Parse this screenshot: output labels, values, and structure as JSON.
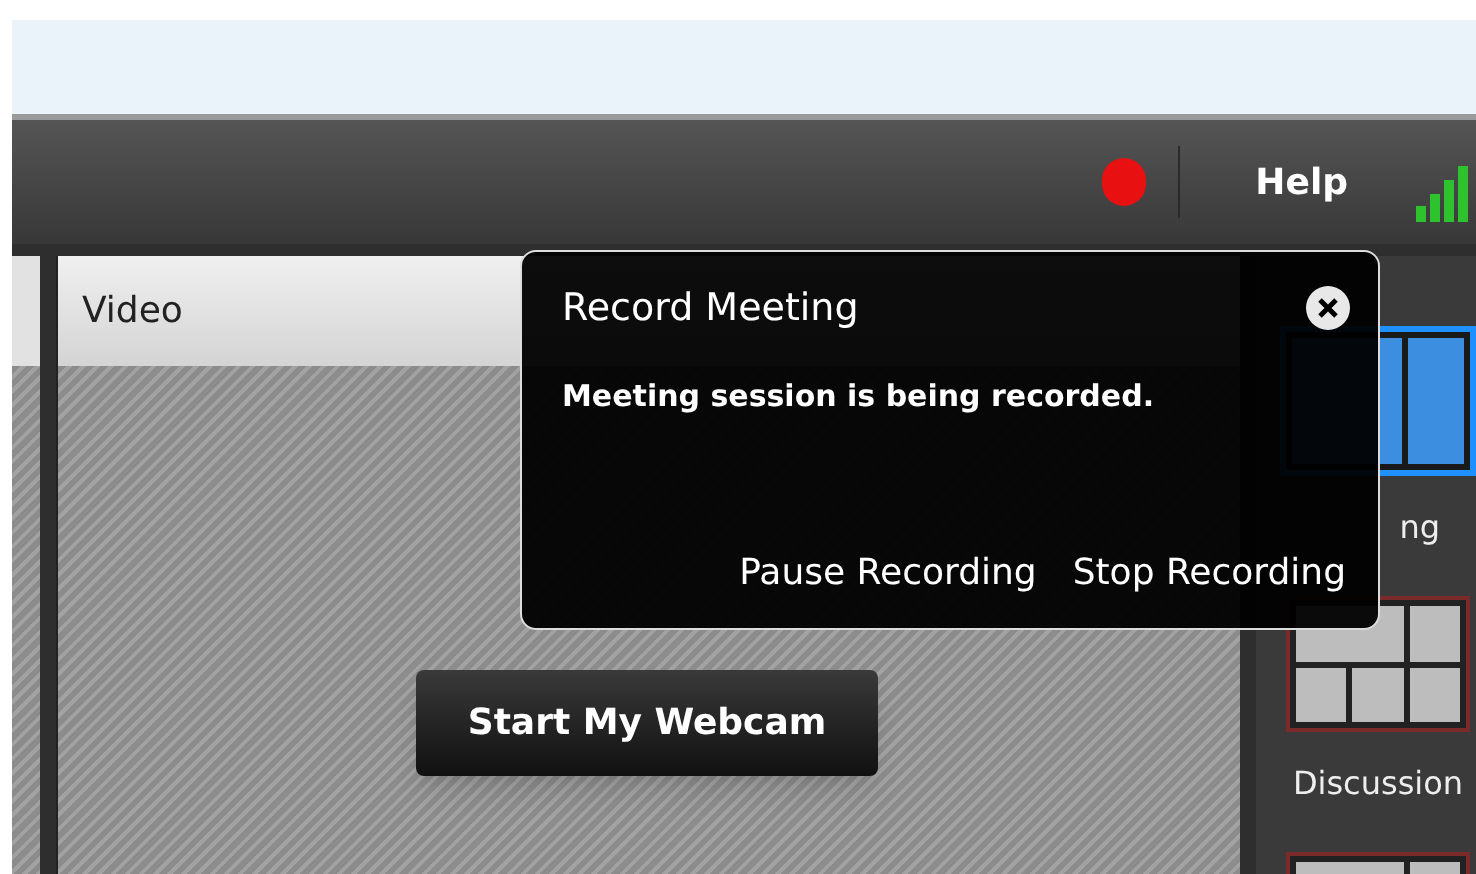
{
  "toolbar": {
    "recording": true,
    "help": "Help"
  },
  "video_panel": {
    "title": "Video",
    "button": "Start My Webcam"
  },
  "layouts": [
    {
      "label": "ng",
      "selected": true
    },
    {
      "label": "Discussion",
      "selected": false
    },
    {
      "selected": false
    }
  ],
  "record_popup": {
    "title": "Record Meeting",
    "message": "Meeting session is being recorded.",
    "actions": [
      "Pause Recording",
      "Stop Recording"
    ]
  }
}
